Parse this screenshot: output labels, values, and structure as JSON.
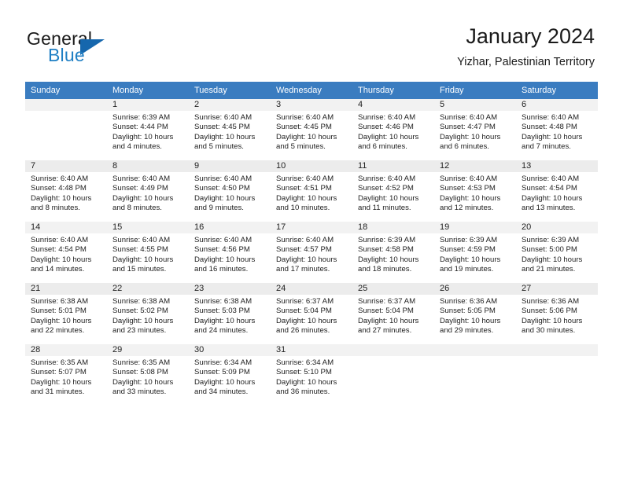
{
  "brand": {
    "name_top": "General",
    "name_bottom": "Blue",
    "accent_color": "#1667ad",
    "text_color": "#1a1a1a"
  },
  "header": {
    "title": "January 2024",
    "location": "Yizhar, Palestinian Territory"
  },
  "calendar": {
    "header_background": "#3a7cc0",
    "header_text_color": "#ffffff",
    "weekday_headers": [
      "Sunday",
      "Monday",
      "Tuesday",
      "Wednesday",
      "Thursday",
      "Friday",
      "Saturday"
    ],
    "weeks": [
      [
        {
          "day": "",
          "sunrise": "",
          "sunset": "",
          "daylight_line1": "",
          "daylight_line2": ""
        },
        {
          "day": "1",
          "sunrise": "Sunrise: 6:39 AM",
          "sunset": "Sunset: 4:44 PM",
          "daylight_line1": "Daylight: 10 hours",
          "daylight_line2": "and 4 minutes."
        },
        {
          "day": "2",
          "sunrise": "Sunrise: 6:40 AM",
          "sunset": "Sunset: 4:45 PM",
          "daylight_line1": "Daylight: 10 hours",
          "daylight_line2": "and 5 minutes."
        },
        {
          "day": "3",
          "sunrise": "Sunrise: 6:40 AM",
          "sunset": "Sunset: 4:45 PM",
          "daylight_line1": "Daylight: 10 hours",
          "daylight_line2": "and 5 minutes."
        },
        {
          "day": "4",
          "sunrise": "Sunrise: 6:40 AM",
          "sunset": "Sunset: 4:46 PM",
          "daylight_line1": "Daylight: 10 hours",
          "daylight_line2": "and 6 minutes."
        },
        {
          "day": "5",
          "sunrise": "Sunrise: 6:40 AM",
          "sunset": "Sunset: 4:47 PM",
          "daylight_line1": "Daylight: 10 hours",
          "daylight_line2": "and 6 minutes."
        },
        {
          "day": "6",
          "sunrise": "Sunrise: 6:40 AM",
          "sunset": "Sunset: 4:48 PM",
          "daylight_line1": "Daylight: 10 hours",
          "daylight_line2": "and 7 minutes."
        }
      ],
      [
        {
          "day": "7",
          "sunrise": "Sunrise: 6:40 AM",
          "sunset": "Sunset: 4:48 PM",
          "daylight_line1": "Daylight: 10 hours",
          "daylight_line2": "and 8 minutes."
        },
        {
          "day": "8",
          "sunrise": "Sunrise: 6:40 AM",
          "sunset": "Sunset: 4:49 PM",
          "daylight_line1": "Daylight: 10 hours",
          "daylight_line2": "and 8 minutes."
        },
        {
          "day": "9",
          "sunrise": "Sunrise: 6:40 AM",
          "sunset": "Sunset: 4:50 PM",
          "daylight_line1": "Daylight: 10 hours",
          "daylight_line2": "and 9 minutes."
        },
        {
          "day": "10",
          "sunrise": "Sunrise: 6:40 AM",
          "sunset": "Sunset: 4:51 PM",
          "daylight_line1": "Daylight: 10 hours",
          "daylight_line2": "and 10 minutes."
        },
        {
          "day": "11",
          "sunrise": "Sunrise: 6:40 AM",
          "sunset": "Sunset: 4:52 PM",
          "daylight_line1": "Daylight: 10 hours",
          "daylight_line2": "and 11 minutes."
        },
        {
          "day": "12",
          "sunrise": "Sunrise: 6:40 AM",
          "sunset": "Sunset: 4:53 PM",
          "daylight_line1": "Daylight: 10 hours",
          "daylight_line2": "and 12 minutes."
        },
        {
          "day": "13",
          "sunrise": "Sunrise: 6:40 AM",
          "sunset": "Sunset: 4:54 PM",
          "daylight_line1": "Daylight: 10 hours",
          "daylight_line2": "and 13 minutes."
        }
      ],
      [
        {
          "day": "14",
          "sunrise": "Sunrise: 6:40 AM",
          "sunset": "Sunset: 4:54 PM",
          "daylight_line1": "Daylight: 10 hours",
          "daylight_line2": "and 14 minutes."
        },
        {
          "day": "15",
          "sunrise": "Sunrise: 6:40 AM",
          "sunset": "Sunset: 4:55 PM",
          "daylight_line1": "Daylight: 10 hours",
          "daylight_line2": "and 15 minutes."
        },
        {
          "day": "16",
          "sunrise": "Sunrise: 6:40 AM",
          "sunset": "Sunset: 4:56 PM",
          "daylight_line1": "Daylight: 10 hours",
          "daylight_line2": "and 16 minutes."
        },
        {
          "day": "17",
          "sunrise": "Sunrise: 6:40 AM",
          "sunset": "Sunset: 4:57 PM",
          "daylight_line1": "Daylight: 10 hours",
          "daylight_line2": "and 17 minutes."
        },
        {
          "day": "18",
          "sunrise": "Sunrise: 6:39 AM",
          "sunset": "Sunset: 4:58 PM",
          "daylight_line1": "Daylight: 10 hours",
          "daylight_line2": "and 18 minutes."
        },
        {
          "day": "19",
          "sunrise": "Sunrise: 6:39 AM",
          "sunset": "Sunset: 4:59 PM",
          "daylight_line1": "Daylight: 10 hours",
          "daylight_line2": "and 19 minutes."
        },
        {
          "day": "20",
          "sunrise": "Sunrise: 6:39 AM",
          "sunset": "Sunset: 5:00 PM",
          "daylight_line1": "Daylight: 10 hours",
          "daylight_line2": "and 21 minutes."
        }
      ],
      [
        {
          "day": "21",
          "sunrise": "Sunrise: 6:38 AM",
          "sunset": "Sunset: 5:01 PM",
          "daylight_line1": "Daylight: 10 hours",
          "daylight_line2": "and 22 minutes."
        },
        {
          "day": "22",
          "sunrise": "Sunrise: 6:38 AM",
          "sunset": "Sunset: 5:02 PM",
          "daylight_line1": "Daylight: 10 hours",
          "daylight_line2": "and 23 minutes."
        },
        {
          "day": "23",
          "sunrise": "Sunrise: 6:38 AM",
          "sunset": "Sunset: 5:03 PM",
          "daylight_line1": "Daylight: 10 hours",
          "daylight_line2": "and 24 minutes."
        },
        {
          "day": "24",
          "sunrise": "Sunrise: 6:37 AM",
          "sunset": "Sunset: 5:04 PM",
          "daylight_line1": "Daylight: 10 hours",
          "daylight_line2": "and 26 minutes."
        },
        {
          "day": "25",
          "sunrise": "Sunrise: 6:37 AM",
          "sunset": "Sunset: 5:04 PM",
          "daylight_line1": "Daylight: 10 hours",
          "daylight_line2": "and 27 minutes."
        },
        {
          "day": "26",
          "sunrise": "Sunrise: 6:36 AM",
          "sunset": "Sunset: 5:05 PM",
          "daylight_line1": "Daylight: 10 hours",
          "daylight_line2": "and 29 minutes."
        },
        {
          "day": "27",
          "sunrise": "Sunrise: 6:36 AM",
          "sunset": "Sunset: 5:06 PM",
          "daylight_line1": "Daylight: 10 hours",
          "daylight_line2": "and 30 minutes."
        }
      ],
      [
        {
          "day": "28",
          "sunrise": "Sunrise: 6:35 AM",
          "sunset": "Sunset: 5:07 PM",
          "daylight_line1": "Daylight: 10 hours",
          "daylight_line2": "and 31 minutes."
        },
        {
          "day": "29",
          "sunrise": "Sunrise: 6:35 AM",
          "sunset": "Sunset: 5:08 PM",
          "daylight_line1": "Daylight: 10 hours",
          "daylight_line2": "and 33 minutes."
        },
        {
          "day": "30",
          "sunrise": "Sunrise: 6:34 AM",
          "sunset": "Sunset: 5:09 PM",
          "daylight_line1": "Daylight: 10 hours",
          "daylight_line2": "and 34 minutes."
        },
        {
          "day": "31",
          "sunrise": "Sunrise: 6:34 AM",
          "sunset": "Sunset: 5:10 PM",
          "daylight_line1": "Daylight: 10 hours",
          "daylight_line2": "and 36 minutes."
        },
        {
          "day": "",
          "sunrise": "",
          "sunset": "",
          "daylight_line1": "",
          "daylight_line2": ""
        },
        {
          "day": "",
          "sunrise": "",
          "sunset": "",
          "daylight_line1": "",
          "daylight_line2": ""
        },
        {
          "day": "",
          "sunrise": "",
          "sunset": "",
          "daylight_line1": "",
          "daylight_line2": ""
        }
      ]
    ]
  }
}
